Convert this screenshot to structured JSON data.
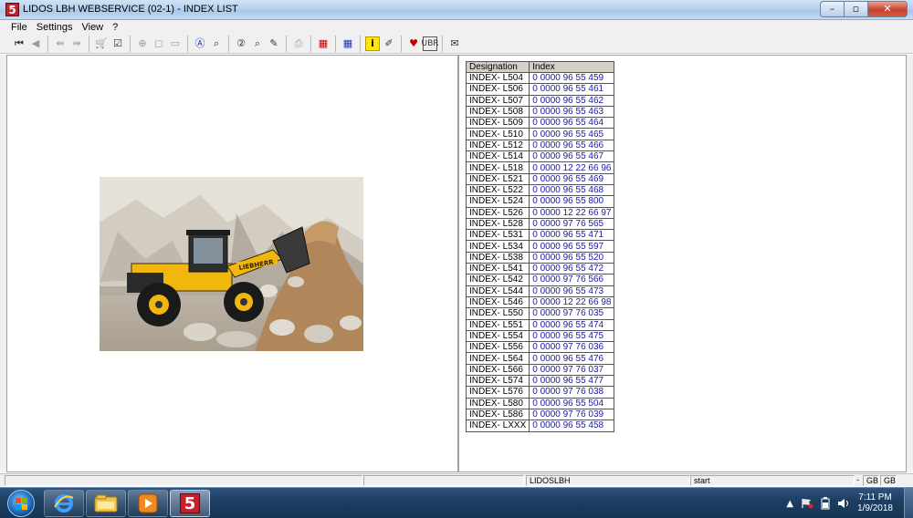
{
  "window": {
    "app_icon_label": "5",
    "title": "LIDOS LBH WEBSERVICE (02-1) - INDEX LIST",
    "minimize_glyph": "–",
    "maximize_glyph": "▫",
    "close_glyph": "✕"
  },
  "menu": {
    "items": [
      "File",
      "Settings",
      "View",
      "?"
    ]
  },
  "toolbar": {
    "groups": [
      [
        {
          "icon": "first-page-icon",
          "glyph": "⏮",
          "tone": "",
          "enabled": true
        },
        {
          "icon": "previous-icon",
          "glyph": "◀",
          "tone": "dim",
          "enabled": false
        }
      ],
      [
        {
          "icon": "back-document-icon",
          "glyph": "⇚",
          "tone": "dim",
          "enabled": false
        },
        {
          "icon": "forward-document-icon",
          "glyph": "⇛",
          "tone": "dim",
          "enabled": false
        }
      ],
      [
        {
          "icon": "cart-icon",
          "glyph": "🛒",
          "tone": "",
          "enabled": true
        },
        {
          "icon": "clipboard-check-icon",
          "glyph": "☑",
          "tone": "",
          "enabled": true
        }
      ],
      [
        {
          "icon": "zoom-icon",
          "glyph": "⊕",
          "tone": "dim",
          "enabled": false
        },
        {
          "icon": "fit-page-icon",
          "glyph": "◻",
          "tone": "dim",
          "enabled": false
        },
        {
          "icon": "fit-width-icon",
          "glyph": "▭",
          "tone": "dim",
          "enabled": false
        }
      ],
      [
        {
          "icon": "search-a-icon",
          "glyph": "Ⓐ",
          "tone": "blue",
          "enabled": true
        },
        {
          "icon": "search-text-icon",
          "glyph": "⌕",
          "tone": "",
          "enabled": true
        }
      ],
      [
        {
          "icon": "search-2-icon",
          "glyph": "②",
          "tone": "",
          "enabled": true
        },
        {
          "icon": "search-number-icon",
          "glyph": "⌕",
          "tone": "",
          "enabled": true
        },
        {
          "icon": "edit-icon",
          "glyph": "✎",
          "tone": "",
          "enabled": true
        }
      ],
      [
        {
          "icon": "print-icon",
          "glyph": "⎙",
          "tone": "dim",
          "enabled": false
        }
      ],
      [
        {
          "icon": "grid-red-icon",
          "glyph": "▦",
          "tone": "red",
          "enabled": true
        }
      ],
      [
        {
          "icon": "grid-blue-icon",
          "glyph": "▦",
          "tone": "blue",
          "enabled": true
        }
      ],
      [
        {
          "icon": "info-icon",
          "glyph": "i",
          "tone": "yellow",
          "enabled": true
        },
        {
          "icon": "notes-icon",
          "glyph": "✐",
          "tone": "",
          "enabled": true
        }
      ],
      [
        {
          "icon": "favorites-icon",
          "glyph": "♥",
          "tone": "red",
          "enabled": true
        },
        {
          "icon": "ubr-icon",
          "glyph": "UBR",
          "tone": "boxed",
          "enabled": true
        }
      ],
      [
        {
          "icon": "mail-icon",
          "glyph": "✉",
          "tone": "",
          "enabled": true
        }
      ]
    ]
  },
  "index_table": {
    "headers": [
      "Designation",
      "Index"
    ],
    "rows": [
      [
        "INDEX- L504",
        "0 0000 96 55 459"
      ],
      [
        "INDEX- L506",
        "0 0000 96 55 461"
      ],
      [
        "INDEX- L507",
        "0 0000 96 55 462"
      ],
      [
        "INDEX- L508",
        "0 0000 96 55 463"
      ],
      [
        "INDEX- L509",
        "0 0000 96 55 464"
      ],
      [
        "INDEX- L510",
        "0 0000 96 55 465"
      ],
      [
        "INDEX- L512",
        "0 0000 96 55 466"
      ],
      [
        "INDEX- L514",
        "0 0000 96 55 467"
      ],
      [
        "INDEX- L518",
        "0 0000 12 22 66 96"
      ],
      [
        "INDEX- L521",
        "0 0000 96 55 469"
      ],
      [
        "INDEX- L522",
        "0 0000 96 55 468"
      ],
      [
        "INDEX- L524",
        "0 0000 96 55 800"
      ],
      [
        "INDEX- L526",
        "0 0000 12 22 66 97"
      ],
      [
        "INDEX- L528",
        "0 0000 97 76 565"
      ],
      [
        "INDEX- L531",
        "0 0000 96 55 471"
      ],
      [
        "INDEX- L534",
        "0 0000 96 55 597"
      ],
      [
        "INDEX- L538",
        "0 0000 96 55 520"
      ],
      [
        "INDEX- L541",
        "0 0000 96 55 472"
      ],
      [
        "INDEX- L542",
        "0 0000 97 76 566"
      ],
      [
        "INDEX- L544",
        "0 0000 96 55 473"
      ],
      [
        "INDEX- L546",
        "0 0000 12 22 66 98"
      ],
      [
        "INDEX- L550",
        "0 0000 97 76 035"
      ],
      [
        "INDEX- L551",
        "0 0000 96 55 474"
      ],
      [
        "INDEX- L554",
        "0 0000 96 55 475"
      ],
      [
        "INDEX- L556",
        "0 0000 97 76 036"
      ],
      [
        "INDEX- L564",
        "0 0000 96 55 476"
      ],
      [
        "INDEX- L566",
        "0 0000 97 76 037"
      ],
      [
        "INDEX- L574",
        "0 0000 96 55 477"
      ],
      [
        "INDEX- L576",
        "0 0000 97 76 038"
      ],
      [
        "INDEX- L580",
        "0 0000 96 55 504"
      ],
      [
        "INDEX- L586",
        "0 0000 97 76 039"
      ],
      [
        "INDEX- LXXX",
        "0 0000 96 55 458"
      ]
    ]
  },
  "photo": {
    "brand_text": "LIEBHERR"
  },
  "statusbar": {
    "server": "LIDOSLBH",
    "mode": "start",
    "separator": "-",
    "lang1": "GB",
    "lang2": "GB"
  },
  "taskbar": {
    "pinned": [
      "internet-explorer-icon",
      "explorer-folder-icon",
      "media-player-icon",
      "lidos-app-icon"
    ],
    "lidos_label": "5",
    "tray_up_glyph": "▲",
    "time": "7:11 PM",
    "date": "1/9/2018"
  },
  "colors": {
    "index_code": "#1a1aa0",
    "header_bg": "#d4d0c8",
    "taskbar": "#1e3e63",
    "app_red": "#c6202a"
  }
}
